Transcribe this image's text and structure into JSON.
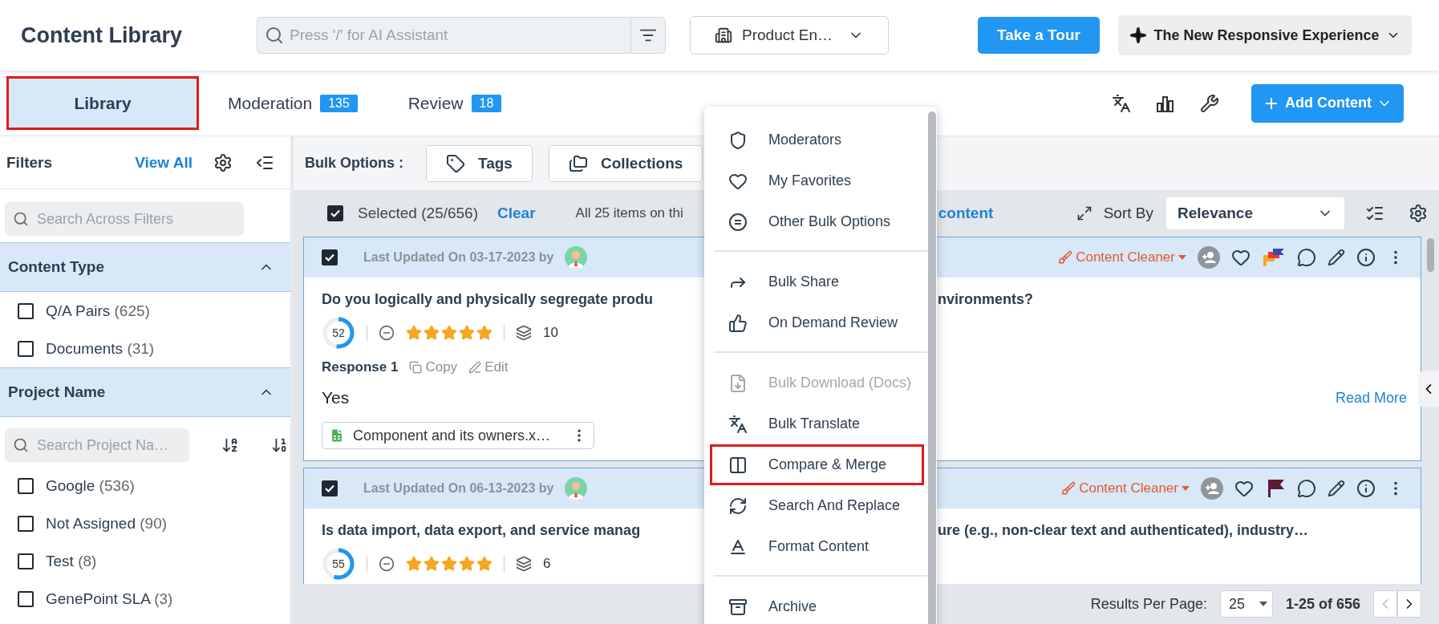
{
  "header": {
    "title": "Content Library",
    "search": {
      "placeholder": "Press '/' for AI Assistant"
    },
    "workspace": "Product En…",
    "tour_button": "Take a Tour",
    "experience": "The New Responsive Experience"
  },
  "tabs": [
    {
      "label": "Library",
      "selected": true,
      "highlighted": true
    },
    {
      "label": "Moderation",
      "badge": "135",
      "selected": false,
      "highlighted": false
    },
    {
      "label": "Review",
      "badge": "18",
      "selected": false,
      "highlighted": false
    }
  ],
  "add_button": "Add Content",
  "filters": {
    "title": "Filters",
    "view_all": "View All",
    "search": {
      "placeholder": "Search Across Filters"
    },
    "sections": [
      {
        "title": "Content Type",
        "expanded": true,
        "options": [
          {
            "label": "Q/A Pairs",
            "count": "(625)",
            "checked": false
          },
          {
            "label": "Documents",
            "count": "(31)",
            "checked": false
          }
        ]
      },
      {
        "title": "Project Name",
        "expanded": true,
        "search": {
          "placeholder": "Search Project Na…"
        },
        "options": [
          {
            "label": "Google",
            "count": "(536)",
            "checked": false
          },
          {
            "label": "Not Assigned",
            "count": "(90)",
            "checked": false
          },
          {
            "label": "Test",
            "count": "(8)",
            "checked": false
          },
          {
            "label": "GenePoint SLA",
            "count": "(3)",
            "checked": false
          }
        ]
      }
    ]
  },
  "bulk": {
    "label": "Bulk Options :",
    "buttons": [
      "Tags",
      "Collections"
    ]
  },
  "selection": {
    "checked": true,
    "label": "Selected",
    "count": "(25/656)",
    "clear": "Clear",
    "notice": "All 25 items on thi",
    "link": "content"
  },
  "sort": {
    "label": "Sort By",
    "value": "Relevance"
  },
  "cards": [
    {
      "checked": true,
      "updated": "Last Updated On 03-17-2023 by",
      "cleaner": "Content Cleaner",
      "flag": {
        "kind": "multi"
      },
      "title_start": "Do you logically and physically segregate produ",
      "title_end": "nvironments?",
      "score": "52",
      "level": 0.52,
      "stars": 5,
      "versions": "10",
      "response": {
        "label": "Response 1",
        "copy": "Copy",
        "edit": "Edit",
        "text": "Yes",
        "read_more": "Read More",
        "attachment": "Component and its owners.x…"
      }
    },
    {
      "checked": true,
      "updated": "Last Updated On 06-13-2023 by",
      "cleaner": "Content Cleaner",
      "flag": {
        "kind": "solid",
        "color": "#5b1c36"
      },
      "title_start": "Is data import, data export, and service manag",
      "title_end": "ure (e.g., non-clear text and authenticated), industry…",
      "score": "55",
      "level": 0.55,
      "stars": 5,
      "versions": "6"
    }
  ],
  "menu": {
    "groups": [
      [
        {
          "label": "Moderators",
          "disabled": false,
          "highlighted": false
        },
        {
          "label": "My Favorites",
          "disabled": false,
          "highlighted": false
        },
        {
          "label": "Other Bulk Options",
          "disabled": false,
          "highlighted": false
        }
      ],
      [
        {
          "label": "Bulk Share",
          "disabled": false,
          "highlighted": false
        },
        {
          "label": "On Demand Review",
          "disabled": false,
          "highlighted": false
        }
      ],
      [
        {
          "label": "Bulk Download (Docs)",
          "disabled": true,
          "highlighted": false
        },
        {
          "label": "Bulk Translate",
          "disabled": false,
          "highlighted": false
        },
        {
          "label": "Compare & Merge",
          "disabled": false,
          "highlighted": true
        },
        {
          "label": "Search And Replace",
          "disabled": false,
          "highlighted": false
        },
        {
          "label": "Format Content",
          "disabled": false,
          "highlighted": false
        }
      ],
      [
        {
          "label": "Archive",
          "disabled": false,
          "highlighted": false
        }
      ]
    ]
  },
  "pagination": {
    "label": "Results Per Page:",
    "per_page": "25",
    "range": "1-25 of 656",
    "previous": {
      "disabled": true
    },
    "next": {
      "disabled": false
    }
  }
}
